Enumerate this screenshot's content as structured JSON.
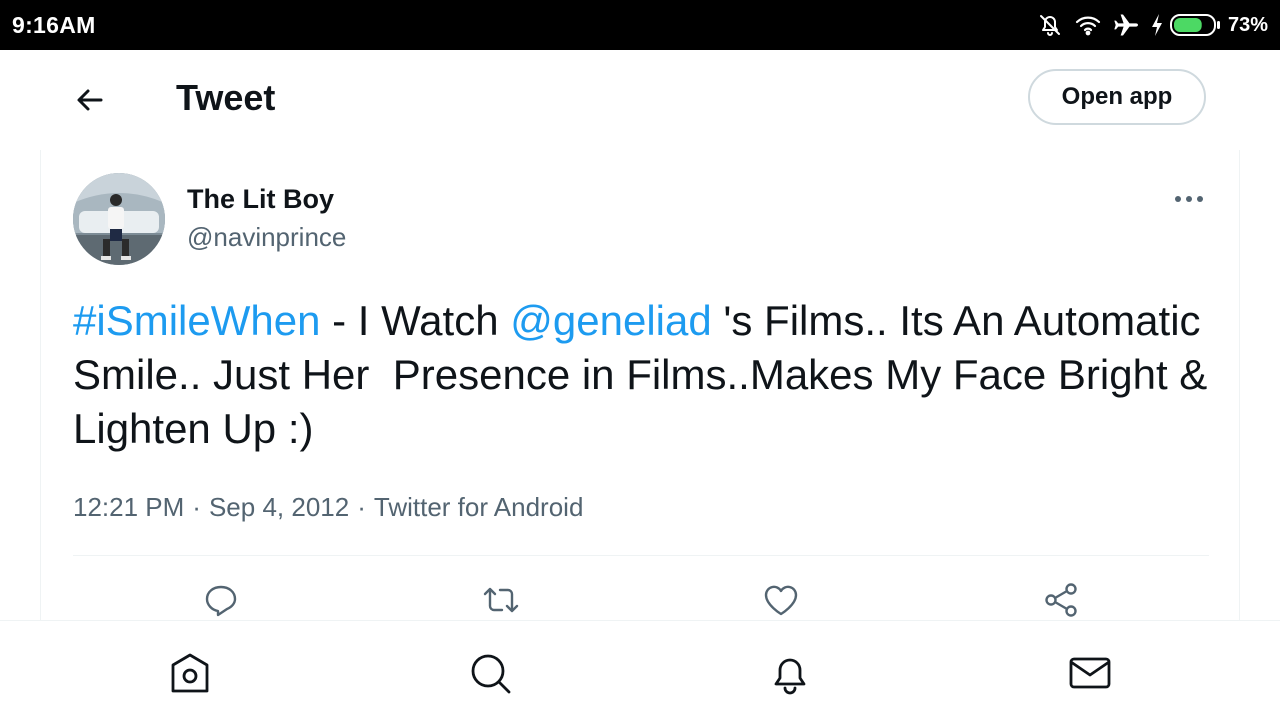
{
  "status_bar": {
    "time": "9:16AM",
    "battery_percent": "73%",
    "battery_level": 0.73,
    "battery_color": "#4cd964",
    "icons": [
      "bell-off-icon",
      "wifi-icon",
      "airplane-icon",
      "charging-bolt-icon",
      "battery-icon"
    ]
  },
  "header": {
    "title": "Tweet",
    "open_app_label": "Open app",
    "icons": [
      "back-arrow-icon"
    ]
  },
  "tweet": {
    "display_name": "The Lit Boy",
    "handle": "@navinprince",
    "text_segments": [
      {
        "text": "#iSmileWhen",
        "type": "hashtag"
      },
      {
        "text": " - I Watch ",
        "type": "text"
      },
      {
        "text": "@geneliad",
        "type": "mention"
      },
      {
        "text": " 's Films.. Its An Automatic Smile.. Just Her  Presence in Films..Makes My Face Bright & Lighten Up :)",
        "type": "text"
      }
    ],
    "time": "12:21 PM",
    "date": "Sep 4, 2012",
    "source": "Twitter for Android",
    "separator": "·",
    "more_icon": "more-horizontal-icon",
    "actions": [
      "reply-icon",
      "retweet-icon",
      "like-icon",
      "share-icon"
    ]
  },
  "bottom_nav": {
    "items": [
      "home-icon",
      "search-icon",
      "notifications-icon",
      "messages-icon"
    ]
  },
  "colors": {
    "accent": "#1d9bf0",
    "text_primary": "#0f1419",
    "text_secondary": "#536471",
    "border": "#cfd9de",
    "status_bar_bg": "#000000"
  }
}
